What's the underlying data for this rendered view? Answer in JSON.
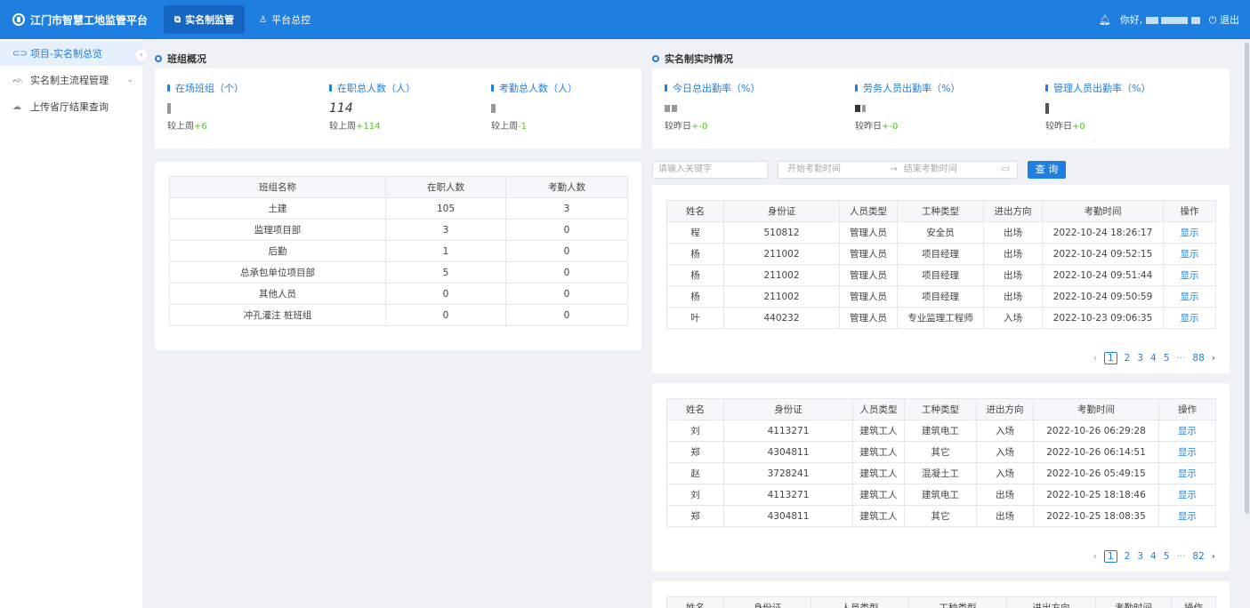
{
  "header": {
    "platform_title": "江门市智慧工地监管平台",
    "tabs": [
      {
        "label": "实名制监管",
        "icon": "id-card-icon"
      },
      {
        "label": "平台总控",
        "icon": "user-icon"
      }
    ],
    "greeting": "你好,",
    "logout_label": "退出"
  },
  "sidebar": {
    "items": [
      {
        "label": "项目-实名制总览",
        "icon": "link-icon"
      },
      {
        "label": "实名制主流程管理",
        "icon": "people-icon"
      },
      {
        "label": "上传省厅结果查询",
        "icon": "cloud-icon"
      }
    ]
  },
  "team_overview": {
    "title": "班组概况",
    "stats": [
      {
        "label": "在场班组（个）",
        "value": "",
        "compare_prefix": "较上周",
        "compare_value": "+6"
      },
      {
        "label": "在职总人数（人）",
        "value": "114",
        "compare_prefix": "较上周",
        "compare_value": "+114"
      },
      {
        "label": "考勤总人数（人）",
        "value": "",
        "compare_prefix": "较上周",
        "compare_value": "-1"
      }
    ],
    "table": {
      "columns": [
        "班组名称",
        "在职人数",
        "考勤人数"
      ],
      "rows": [
        [
          "土建",
          "105",
          "3"
        ],
        [
          "监理项目部",
          "3",
          "0"
        ],
        [
          "后勤",
          "1",
          "0"
        ],
        [
          "总承包单位项目部",
          "5",
          "0"
        ],
        [
          "其他人员",
          "0",
          "0"
        ],
        [
          "冲孔灌注 桩班组",
          "0",
          "0"
        ]
      ]
    }
  },
  "realtime": {
    "title": "实名制实时情况",
    "stats": [
      {
        "label": "今日总出勤率（%）",
        "compare_prefix": "较昨日",
        "compare_value": "+-0"
      },
      {
        "label": "劳务人员出勤率（%）",
        "compare_prefix": "较昨日",
        "compare_value": "+-0"
      },
      {
        "label": "管理人员出勤率（%）",
        "compare_prefix": "较昨日",
        "compare_value": "+0"
      }
    ],
    "search": {
      "keyword_placeholder": "请输入关键字",
      "start_placeholder": "开始考勤时间",
      "range_sep": "→",
      "end_placeholder": "结束考勤时间",
      "button": "查 询"
    },
    "columns": [
      "姓名",
      "身份证",
      "人员类型",
      "工种类型",
      "进出方向",
      "考勤时间",
      "操作"
    ],
    "table1": {
      "rows": [
        [
          "程",
          "510812",
          "管理人员",
          "安全员",
          "出场",
          "2022-10-24 18:26:17",
          "显示"
        ],
        [
          "杨",
          "211002",
          "管理人员",
          "项目经理",
          "出场",
          "2022-10-24 09:52:15",
          "显示"
        ],
        [
          "杨",
          "211002",
          "管理人员",
          "项目经理",
          "出场",
          "2022-10-24 09:51:44",
          "显示"
        ],
        [
          "杨",
          "211002",
          "管理人员",
          "项目经理",
          "出场",
          "2022-10-24 09:50:59",
          "显示"
        ],
        [
          "叶",
          "440232",
          "管理人员",
          "专业监理工程师",
          "入场",
          "2022-10-23 09:06:35",
          "显示"
        ]
      ],
      "pager": {
        "pages": [
          "1",
          "2",
          "3",
          "4",
          "5"
        ],
        "last": "88"
      }
    },
    "table2": {
      "rows": [
        [
          "刘",
          "4113271",
          "建筑工人",
          "建筑电工",
          "入场",
          "2022-10-26 06:29:28",
          "显示"
        ],
        [
          "郑",
          "4304811",
          "建筑工人",
          "其它",
          "入场",
          "2022-10-26 06:14:51",
          "显示"
        ],
        [
          "赵",
          "3728241",
          "建筑工人",
          "混凝土工",
          "入场",
          "2022-10-26 05:49:15",
          "显示"
        ],
        [
          "刘",
          "4113271",
          "建筑工人",
          "建筑电工",
          "出场",
          "2022-10-25 18:18:46",
          "显示"
        ],
        [
          "郑",
          "4304811",
          "建筑工人",
          "其它",
          "出场",
          "2022-10-25 18:08:35",
          "显示"
        ]
      ],
      "pager": {
        "pages": [
          "1",
          "2",
          "3",
          "4",
          "5"
        ],
        "last": "82"
      }
    },
    "table3": {
      "rows": []
    }
  }
}
